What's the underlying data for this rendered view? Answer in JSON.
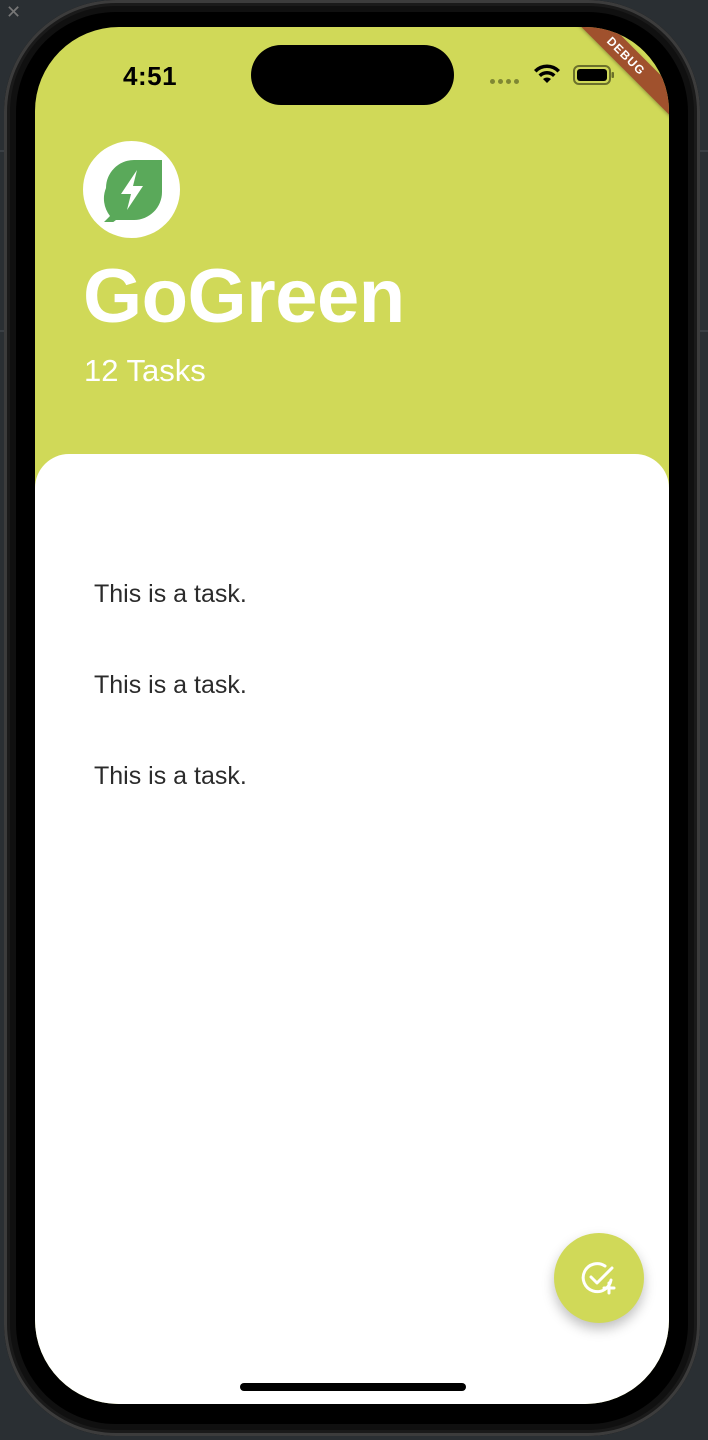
{
  "status_bar": {
    "time": "4:51"
  },
  "debug_banner": {
    "label": "DEBUG"
  },
  "header": {
    "title": "GoGreen",
    "task_count": "12 Tasks",
    "logo_icon": "leaf-bolt-icon"
  },
  "tasks": [
    {
      "label": "This is a task."
    },
    {
      "label": "This is a task."
    },
    {
      "label": "This is a task."
    }
  ],
  "fab": {
    "icon": "add-task-icon"
  },
  "colors": {
    "accent": "#d0d958",
    "logo_green": "#5aa95a",
    "debug_ribbon": "#a0512d"
  }
}
